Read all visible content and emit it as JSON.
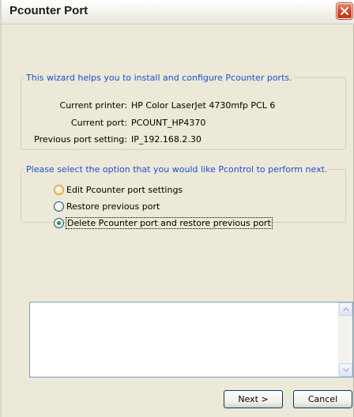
{
  "window": {
    "title": "Pcounter Port"
  },
  "info_group": {
    "legend": "This wizard helps you to install and configure Pcounter ports.",
    "rows": [
      {
        "label": "Current printer:",
        "value": "HP Color LaserJet 4730mfp PCL 6"
      },
      {
        "label": "Current port:",
        "value": "PCOUNT_HP4370"
      },
      {
        "label": "Previous port setting:",
        "value": "IP_192.168.2.30"
      }
    ]
  },
  "options_group": {
    "legend": "Please select the option that you would like Pcontrol to perform next.",
    "options": [
      {
        "label": "Edit Pcounter port settings",
        "selected": false
      },
      {
        "label": "Restore previous port",
        "selected": false
      },
      {
        "label": "Delete Pcounter port and restore previous port",
        "selected": true
      }
    ]
  },
  "log_box": {
    "value": ""
  },
  "buttons": {
    "next": "Next >",
    "cancel": "Cancel"
  },
  "icons": {
    "close": "close-icon",
    "scroll_up": "scroll-up-arrow-icon",
    "scroll_down": "scroll-down-arrow-icon"
  },
  "colors": {
    "legend_text": "#1d4fd0",
    "dialog_bg": "#ece9d8",
    "close_button": "#d0462a"
  }
}
